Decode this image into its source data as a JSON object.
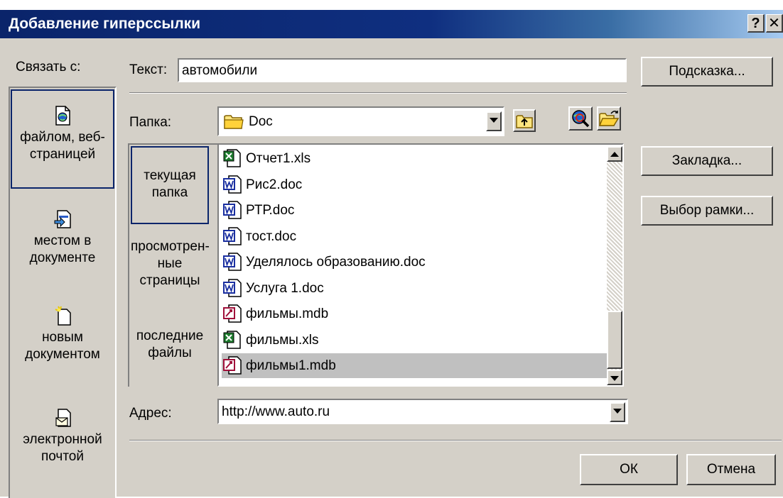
{
  "window": {
    "title": "Добавление гиперссылки",
    "help_glyph": "?",
    "close_glyph": "✕"
  },
  "link_to": {
    "label": "Связать с:",
    "items": [
      {
        "label": "файлом, веб-страницей",
        "line1": "файлом, веб-",
        "line2": "страницей",
        "icon": "web-file-icon",
        "selected": true
      },
      {
        "label": "местом в документе",
        "line1": "местом в",
        "line2": "документе",
        "icon": "document-place-icon",
        "selected": false
      },
      {
        "label": "новым документом",
        "line1": "новым",
        "line2": "документом",
        "icon": "new-document-icon",
        "selected": false
      },
      {
        "label": "электронной почтой",
        "line1": "электронной",
        "line2": "почтой",
        "icon": "email-icon",
        "selected": false
      }
    ]
  },
  "text_field": {
    "label": "Текст:",
    "value": "автомобили"
  },
  "buttons": {
    "hint": "Подсказка...",
    "bookmark": "Закладка...",
    "frame": "Выбор рамки...",
    "ok": "ОК",
    "cancel": "Отмена"
  },
  "folder": {
    "label": "Папка:",
    "value": "Doc",
    "icon": "folder-icon",
    "tools": [
      "up-folder-icon",
      "web-search-icon",
      "open-folder-icon"
    ]
  },
  "places": [
    {
      "line1": "текущая",
      "line2": "папка",
      "line3": "",
      "selected": true
    },
    {
      "line1": "просмотрен-",
      "line2": "ные",
      "line3": "страницы",
      "selected": false
    },
    {
      "line1": "последние",
      "line2": "файлы",
      "line3": "",
      "selected": false
    }
  ],
  "files": [
    {
      "name": "Отчет1.xls",
      "type": "xls",
      "selected": false
    },
    {
      "name": "Рис2.doc",
      "type": "doc",
      "selected": false
    },
    {
      "name": "РТР.doc",
      "type": "doc",
      "selected": false
    },
    {
      "name": "тост.doc",
      "type": "doc",
      "selected": false
    },
    {
      "name": "Уделялось образованию.doc",
      "type": "doc",
      "selected": false
    },
    {
      "name": "Услуга 1.doc",
      "type": "doc",
      "selected": false
    },
    {
      "name": "фильмы.mdb",
      "type": "mdb",
      "selected": false
    },
    {
      "name": "фильмы.xls",
      "type": "xls",
      "selected": false
    },
    {
      "name": "фильмы1.mdb",
      "type": "mdb",
      "selected": true
    }
  ],
  "address": {
    "label": "Адрес:",
    "value": "http://www.auto.ru"
  },
  "colors": {
    "title_bar": "#0a246a",
    "face": "#d4d0c8",
    "selection_border": "#0a246a",
    "selected_row": "#c0c0c0"
  }
}
